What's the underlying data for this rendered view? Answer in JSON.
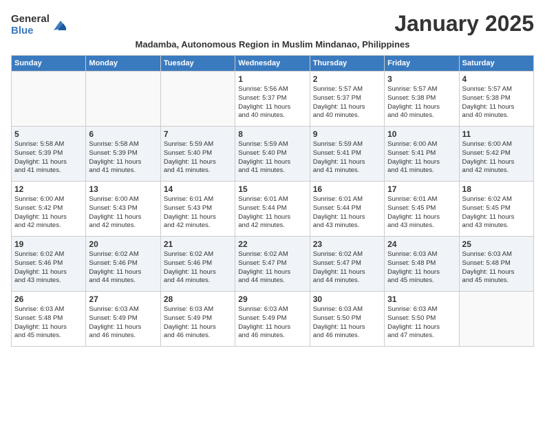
{
  "logo": {
    "general": "General",
    "blue": "Blue"
  },
  "title": "January 2025",
  "subtitle": "Madamba, Autonomous Region in Muslim Mindanao, Philippines",
  "weekdays": [
    "Sunday",
    "Monday",
    "Tuesday",
    "Wednesday",
    "Thursday",
    "Friday",
    "Saturday"
  ],
  "weeks": [
    [
      {
        "day": "",
        "info": ""
      },
      {
        "day": "",
        "info": ""
      },
      {
        "day": "",
        "info": ""
      },
      {
        "day": "1",
        "info": "Sunrise: 5:56 AM\nSunset: 5:37 PM\nDaylight: 11 hours\nand 40 minutes."
      },
      {
        "day": "2",
        "info": "Sunrise: 5:57 AM\nSunset: 5:37 PM\nDaylight: 11 hours\nand 40 minutes."
      },
      {
        "day": "3",
        "info": "Sunrise: 5:57 AM\nSunset: 5:38 PM\nDaylight: 11 hours\nand 40 minutes."
      },
      {
        "day": "4",
        "info": "Sunrise: 5:57 AM\nSunset: 5:38 PM\nDaylight: 11 hours\nand 40 minutes."
      }
    ],
    [
      {
        "day": "5",
        "info": "Sunrise: 5:58 AM\nSunset: 5:39 PM\nDaylight: 11 hours\nand 41 minutes."
      },
      {
        "day": "6",
        "info": "Sunrise: 5:58 AM\nSunset: 5:39 PM\nDaylight: 11 hours\nand 41 minutes."
      },
      {
        "day": "7",
        "info": "Sunrise: 5:59 AM\nSunset: 5:40 PM\nDaylight: 11 hours\nand 41 minutes."
      },
      {
        "day": "8",
        "info": "Sunrise: 5:59 AM\nSunset: 5:40 PM\nDaylight: 11 hours\nand 41 minutes."
      },
      {
        "day": "9",
        "info": "Sunrise: 5:59 AM\nSunset: 5:41 PM\nDaylight: 11 hours\nand 41 minutes."
      },
      {
        "day": "10",
        "info": "Sunrise: 6:00 AM\nSunset: 5:41 PM\nDaylight: 11 hours\nand 41 minutes."
      },
      {
        "day": "11",
        "info": "Sunrise: 6:00 AM\nSunset: 5:42 PM\nDaylight: 11 hours\nand 42 minutes."
      }
    ],
    [
      {
        "day": "12",
        "info": "Sunrise: 6:00 AM\nSunset: 5:42 PM\nDaylight: 11 hours\nand 42 minutes."
      },
      {
        "day": "13",
        "info": "Sunrise: 6:00 AM\nSunset: 5:43 PM\nDaylight: 11 hours\nand 42 minutes."
      },
      {
        "day": "14",
        "info": "Sunrise: 6:01 AM\nSunset: 5:43 PM\nDaylight: 11 hours\nand 42 minutes."
      },
      {
        "day": "15",
        "info": "Sunrise: 6:01 AM\nSunset: 5:44 PM\nDaylight: 11 hours\nand 42 minutes."
      },
      {
        "day": "16",
        "info": "Sunrise: 6:01 AM\nSunset: 5:44 PM\nDaylight: 11 hours\nand 43 minutes."
      },
      {
        "day": "17",
        "info": "Sunrise: 6:01 AM\nSunset: 5:45 PM\nDaylight: 11 hours\nand 43 minutes."
      },
      {
        "day": "18",
        "info": "Sunrise: 6:02 AM\nSunset: 5:45 PM\nDaylight: 11 hours\nand 43 minutes."
      }
    ],
    [
      {
        "day": "19",
        "info": "Sunrise: 6:02 AM\nSunset: 5:46 PM\nDaylight: 11 hours\nand 43 minutes."
      },
      {
        "day": "20",
        "info": "Sunrise: 6:02 AM\nSunset: 5:46 PM\nDaylight: 11 hours\nand 44 minutes."
      },
      {
        "day": "21",
        "info": "Sunrise: 6:02 AM\nSunset: 5:46 PM\nDaylight: 11 hours\nand 44 minutes."
      },
      {
        "day": "22",
        "info": "Sunrise: 6:02 AM\nSunset: 5:47 PM\nDaylight: 11 hours\nand 44 minutes."
      },
      {
        "day": "23",
        "info": "Sunrise: 6:02 AM\nSunset: 5:47 PM\nDaylight: 11 hours\nand 44 minutes."
      },
      {
        "day": "24",
        "info": "Sunrise: 6:03 AM\nSunset: 5:48 PM\nDaylight: 11 hours\nand 45 minutes."
      },
      {
        "day": "25",
        "info": "Sunrise: 6:03 AM\nSunset: 5:48 PM\nDaylight: 11 hours\nand 45 minutes."
      }
    ],
    [
      {
        "day": "26",
        "info": "Sunrise: 6:03 AM\nSunset: 5:48 PM\nDaylight: 11 hours\nand 45 minutes."
      },
      {
        "day": "27",
        "info": "Sunrise: 6:03 AM\nSunset: 5:49 PM\nDaylight: 11 hours\nand 46 minutes."
      },
      {
        "day": "28",
        "info": "Sunrise: 6:03 AM\nSunset: 5:49 PM\nDaylight: 11 hours\nand 46 minutes."
      },
      {
        "day": "29",
        "info": "Sunrise: 6:03 AM\nSunset: 5:49 PM\nDaylight: 11 hours\nand 46 minutes."
      },
      {
        "day": "30",
        "info": "Sunrise: 6:03 AM\nSunset: 5:50 PM\nDaylight: 11 hours\nand 46 minutes."
      },
      {
        "day": "31",
        "info": "Sunrise: 6:03 AM\nSunset: 5:50 PM\nDaylight: 11 hours\nand 47 minutes."
      },
      {
        "day": "",
        "info": ""
      }
    ]
  ]
}
